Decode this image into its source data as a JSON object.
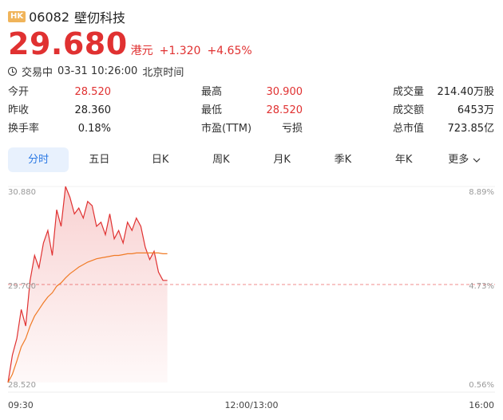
{
  "stock": {
    "market_badge": "HK",
    "code": "06082",
    "name": "壁仞科技",
    "price": "29.680",
    "currency": "港元",
    "change": "+1.320",
    "change_pct": "+4.65%"
  },
  "status": {
    "state": "交易中",
    "time": "03-31 10:26:00",
    "zone": "北京时间"
  },
  "stats": [
    {
      "label": "今开",
      "value": "28.520",
      "color": "red"
    },
    {
      "label": "最高",
      "value": "30.900",
      "color": "red"
    },
    {
      "label": "成交量",
      "value": "214.40万股",
      "color": "dark"
    },
    {
      "label": "昨收",
      "value": "28.360",
      "color": "dark"
    },
    {
      "label": "最低",
      "value": "28.520",
      "color": "red"
    },
    {
      "label": "成交额",
      "value": "6453万",
      "color": "dark"
    },
    {
      "label": "换手率",
      "value": "0.18%",
      "color": "dark"
    },
    {
      "label": "市盈(TTM)",
      "value": "亏损",
      "color": "dark"
    },
    {
      "label": "总市值",
      "value": "723.85亿",
      "color": "dark"
    }
  ],
  "tabs": [
    "分时",
    "五日",
    "日K",
    "周K",
    "月K",
    "季K",
    "年K",
    "更多"
  ],
  "active_tab": "分时",
  "colors": {
    "up": "#e03131",
    "avg_line": "#f07a25",
    "active_tab_bg": "#e8f1fd",
    "active_tab_text": "#2a78e4"
  },
  "chart_data": {
    "type": "line",
    "y_left_ticks": [
      "30.880",
      "29.700",
      "28.520"
    ],
    "y_right_ticks": [
      "8.89%",
      "4.73%",
      "0.56%"
    ],
    "x_ticks": [
      "09:30",
      "12:00/13:00",
      "16:00"
    ],
    "ylim": [
      28.52,
      30.88
    ],
    "prev_close": 29.7,
    "total_minutes": 330,
    "series": [
      {
        "role": "price",
        "values": [
          28.52,
          28.85,
          29.05,
          29.4,
          29.2,
          29.75,
          30.05,
          29.9,
          30.2,
          30.35,
          30.05,
          30.6,
          30.4,
          30.88,
          30.75,
          30.55,
          30.62,
          30.5,
          30.7,
          30.65,
          30.4,
          30.45,
          30.3,
          30.55,
          30.25,
          30.35,
          30.2,
          30.45,
          30.35,
          30.5,
          30.4,
          30.15,
          30.0,
          30.1,
          29.85,
          29.75,
          29.75
        ]
      },
      {
        "role": "average",
        "values": [
          28.52,
          28.62,
          28.78,
          28.95,
          29.05,
          29.2,
          29.32,
          29.4,
          29.48,
          29.55,
          29.6,
          29.68,
          29.72,
          29.78,
          29.83,
          29.87,
          29.91,
          29.94,
          29.97,
          29.99,
          30.01,
          30.02,
          30.03,
          30.04,
          30.05,
          30.05,
          30.06,
          30.07,
          30.07,
          30.08,
          30.08,
          30.08,
          30.08,
          30.08,
          30.08,
          30.07,
          30.07
        ]
      }
    ]
  }
}
